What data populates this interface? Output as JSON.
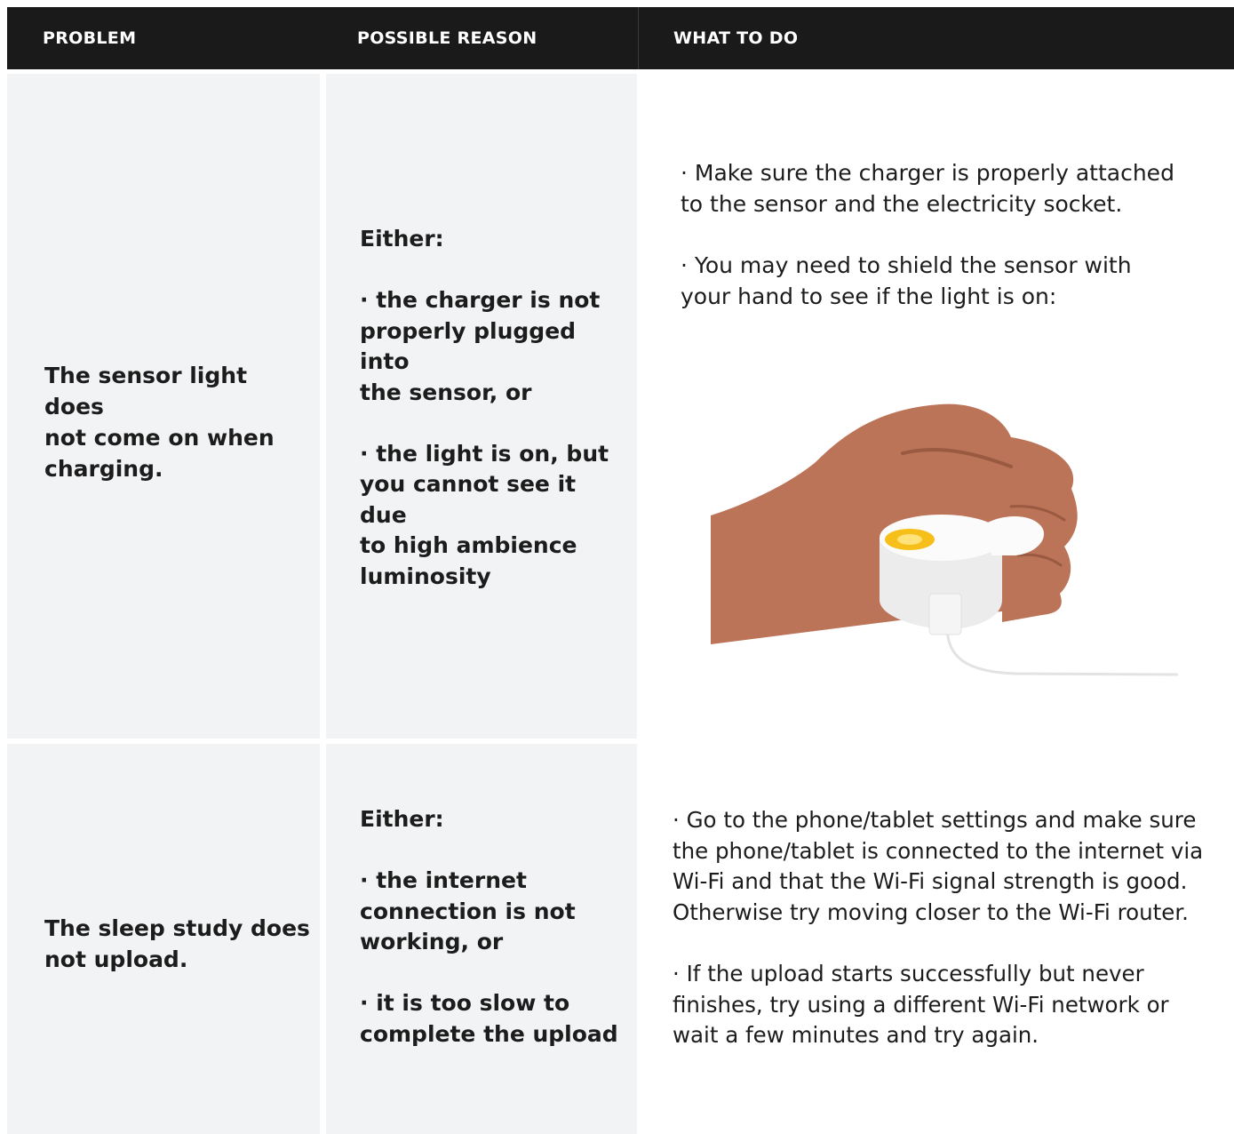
{
  "header": {
    "problem": "PROBLEM",
    "reason": "POSSIBLE REASON",
    "todo": "WHAT TO DO"
  },
  "rows": [
    {
      "problem": [
        "The sensor light does",
        "not come on when",
        "charging."
      ],
      "reason": {
        "intro": "Either:",
        "items": [
          [
            "· the charger is not",
            "properly plugged into",
            "the sensor, or"
          ],
          [
            "· the light is on, but",
            "you cannot see it due",
            "to high ambience",
            "luminosity"
          ]
        ]
      },
      "todo": [
        [
          "· Make sure the charger is properly attached",
          "to the sensor and the electricity socket."
        ],
        [
          "· You may need to shield the sensor with",
          "your hand to see if the light is on:"
        ]
      ],
      "illustration_icon": "hand-holding-sensor-icon"
    },
    {
      "problem": [
        "The sleep study does",
        "not upload."
      ],
      "reason": {
        "intro": "Either:",
        "items": [
          [
            "· the internet",
            "connection is not",
            "working, or"
          ],
          [
            "· it is too slow to",
            "complete the upload"
          ]
        ]
      },
      "todo": [
        [
          "· Go to the phone/tablet settings and make sure",
          "the phone/tablet is connected to the internet via",
          "Wi-Fi and that the Wi-Fi signal strength is good.",
          "Otherwise try moving closer to the Wi-Fi router."
        ],
        [
          "· If the upload starts successfully but never",
          "finishes, try using a different Wi-Fi network or",
          "wait a few minutes and try again."
        ]
      ]
    }
  ],
  "colors": {
    "header_bg": "#1a1a1a",
    "cell_bg": "#f2f3f5",
    "skin": "#bb7458",
    "light": "#f5b800"
  }
}
